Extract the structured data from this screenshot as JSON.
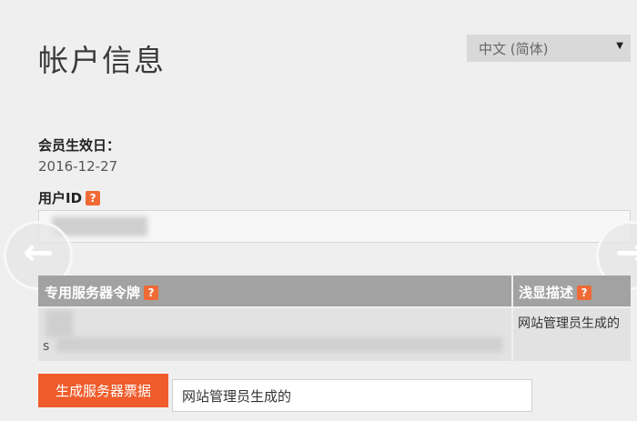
{
  "header": {
    "title": "帐户信息"
  },
  "language": {
    "selected": "中文 (简体)"
  },
  "membership": {
    "label": "会员生效日：",
    "date": "2016-12-27"
  },
  "user_id": {
    "label": "用户ID",
    "help": "?"
  },
  "token_table": {
    "col_token": "专用服务器令牌",
    "col_desc": "浅显描述",
    "help": "?",
    "row_token_fragment": "s",
    "row_desc": "网站管理员生成的"
  },
  "actions": {
    "generate_button": "生成服务器票据",
    "description_value": "网站管理员生成的"
  },
  "colors": {
    "accent": "#f05c2b",
    "header_bg": "#a2a2a2"
  }
}
